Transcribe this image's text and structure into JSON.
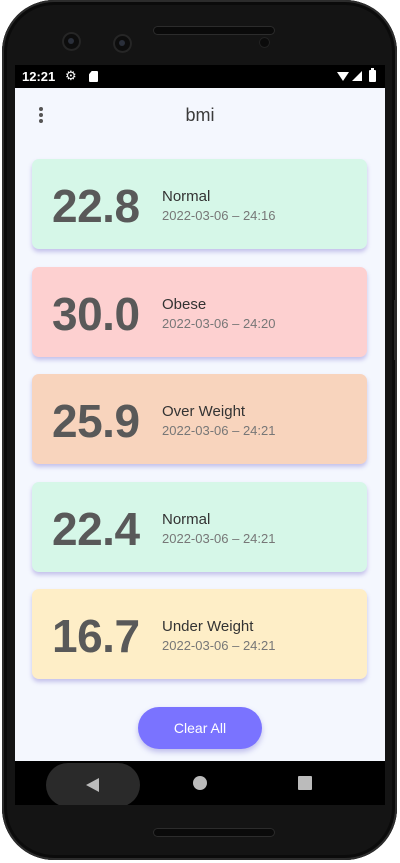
{
  "status_bar": {
    "time": "12:21",
    "icons": [
      "gear-icon",
      "sd-card-icon",
      "wifi-icon",
      "signal-icon",
      "battery-icon"
    ]
  },
  "app_bar": {
    "title": "bmi",
    "menu_icon": "more-vert-icon"
  },
  "records": [
    {
      "value": "22.8",
      "status": "Normal",
      "date": "2022-03-06 – 24:16",
      "color": "#d6f7e8"
    },
    {
      "value": "30.0",
      "status": "Obese",
      "date": "2022-03-06 – 24:20",
      "color": "#fdd0d0"
    },
    {
      "value": "25.9",
      "status": "Over Weight",
      "date": "2022-03-06 – 24:21",
      "color": "#f8d4bd"
    },
    {
      "value": "22.4",
      "status": "Normal",
      "date": "2022-03-06 – 24:21",
      "color": "#d6f7e8"
    },
    {
      "value": "16.7",
      "status": "Under Weight",
      "date": "2022-03-06 – 24:21",
      "color": "#feeec7"
    }
  ],
  "clear_button": {
    "label": "Clear All",
    "color": "#7a73ff"
  },
  "nav_bar": {
    "icons": [
      "back-icon",
      "home-icon",
      "recents-icon"
    ]
  }
}
